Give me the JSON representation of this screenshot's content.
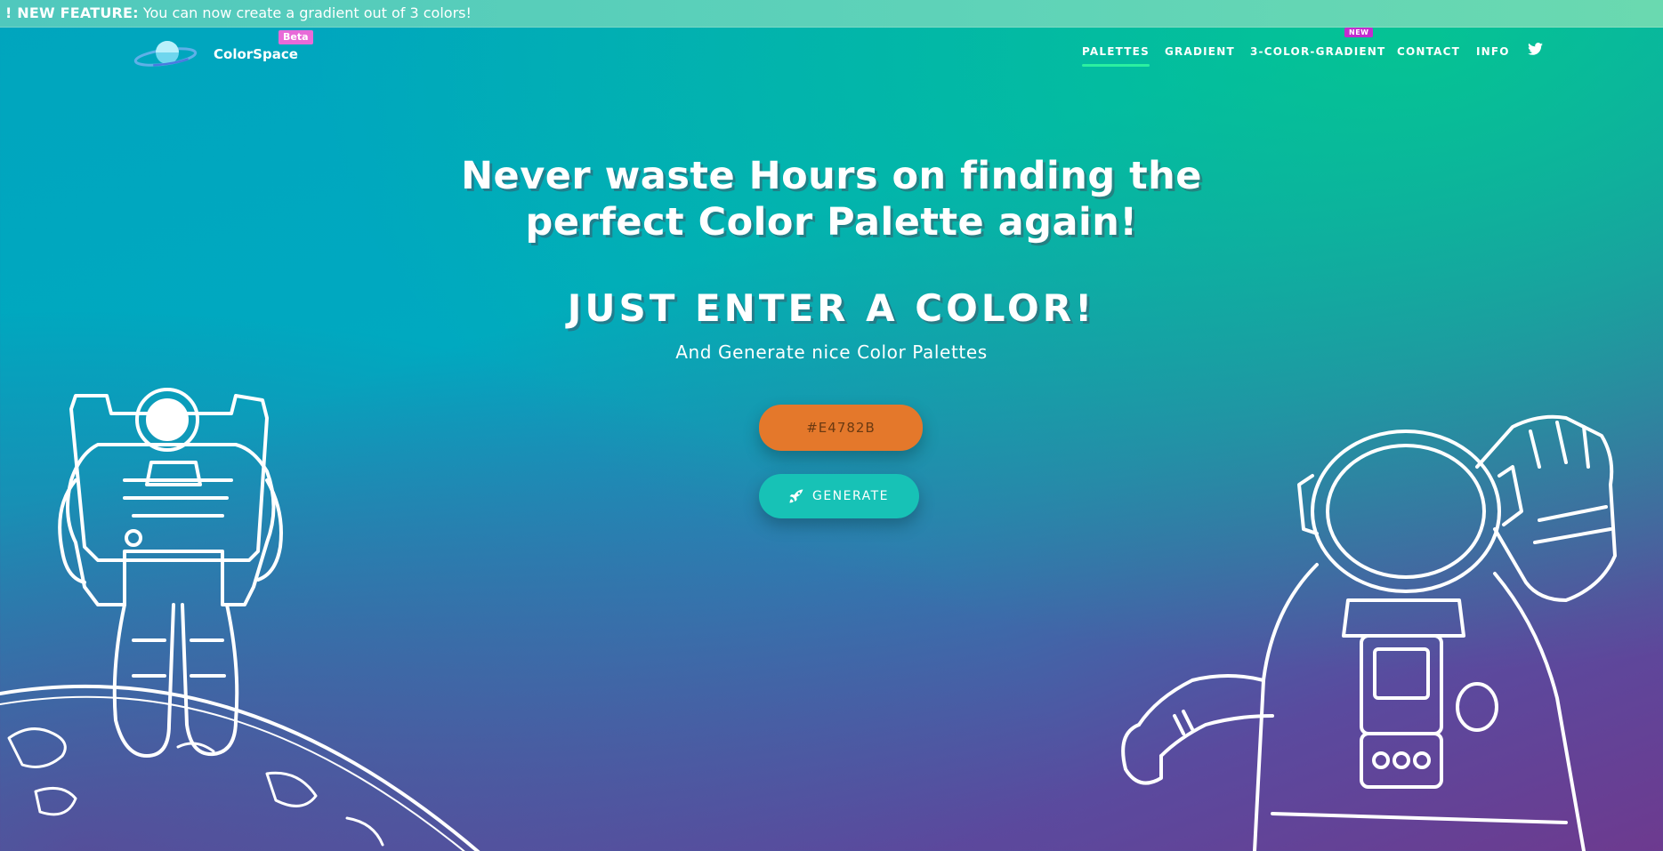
{
  "announcement": {
    "label": "! NEW FEATURE:",
    "text": " You can now create a gradient out of 3 colors!"
  },
  "brand": {
    "name": "ColorSpace",
    "badge": "Beta"
  },
  "nav": {
    "items": [
      {
        "label": "PALETTES",
        "active": true
      },
      {
        "label": "GRADIENT",
        "active": false
      },
      {
        "label": "3-COLOR-GRADIENT",
        "active": false,
        "badge": "NEW"
      },
      {
        "label": "CONTACT",
        "active": false
      },
      {
        "label": "INFO",
        "active": false
      }
    ],
    "twitter_icon": "twitter-icon"
  },
  "hero": {
    "headline_line1": "Never waste Hours on finding the",
    "headline_line2": "perfect Color Palette again!",
    "subheading": "JUST ENTER A COLOR!",
    "tagline": "And Generate nice Color Palettes",
    "color_input_value": "#E4782B",
    "generate_label": "GENERATE",
    "generate_icon": "rocket-icon"
  },
  "colors": {
    "input_bg": "#e4782b",
    "button_bg": "#17c2b6",
    "nav_active_underline": "#2bf0a0",
    "beta_badge": "#e86ad8",
    "new_badge": "#c32ccf"
  }
}
